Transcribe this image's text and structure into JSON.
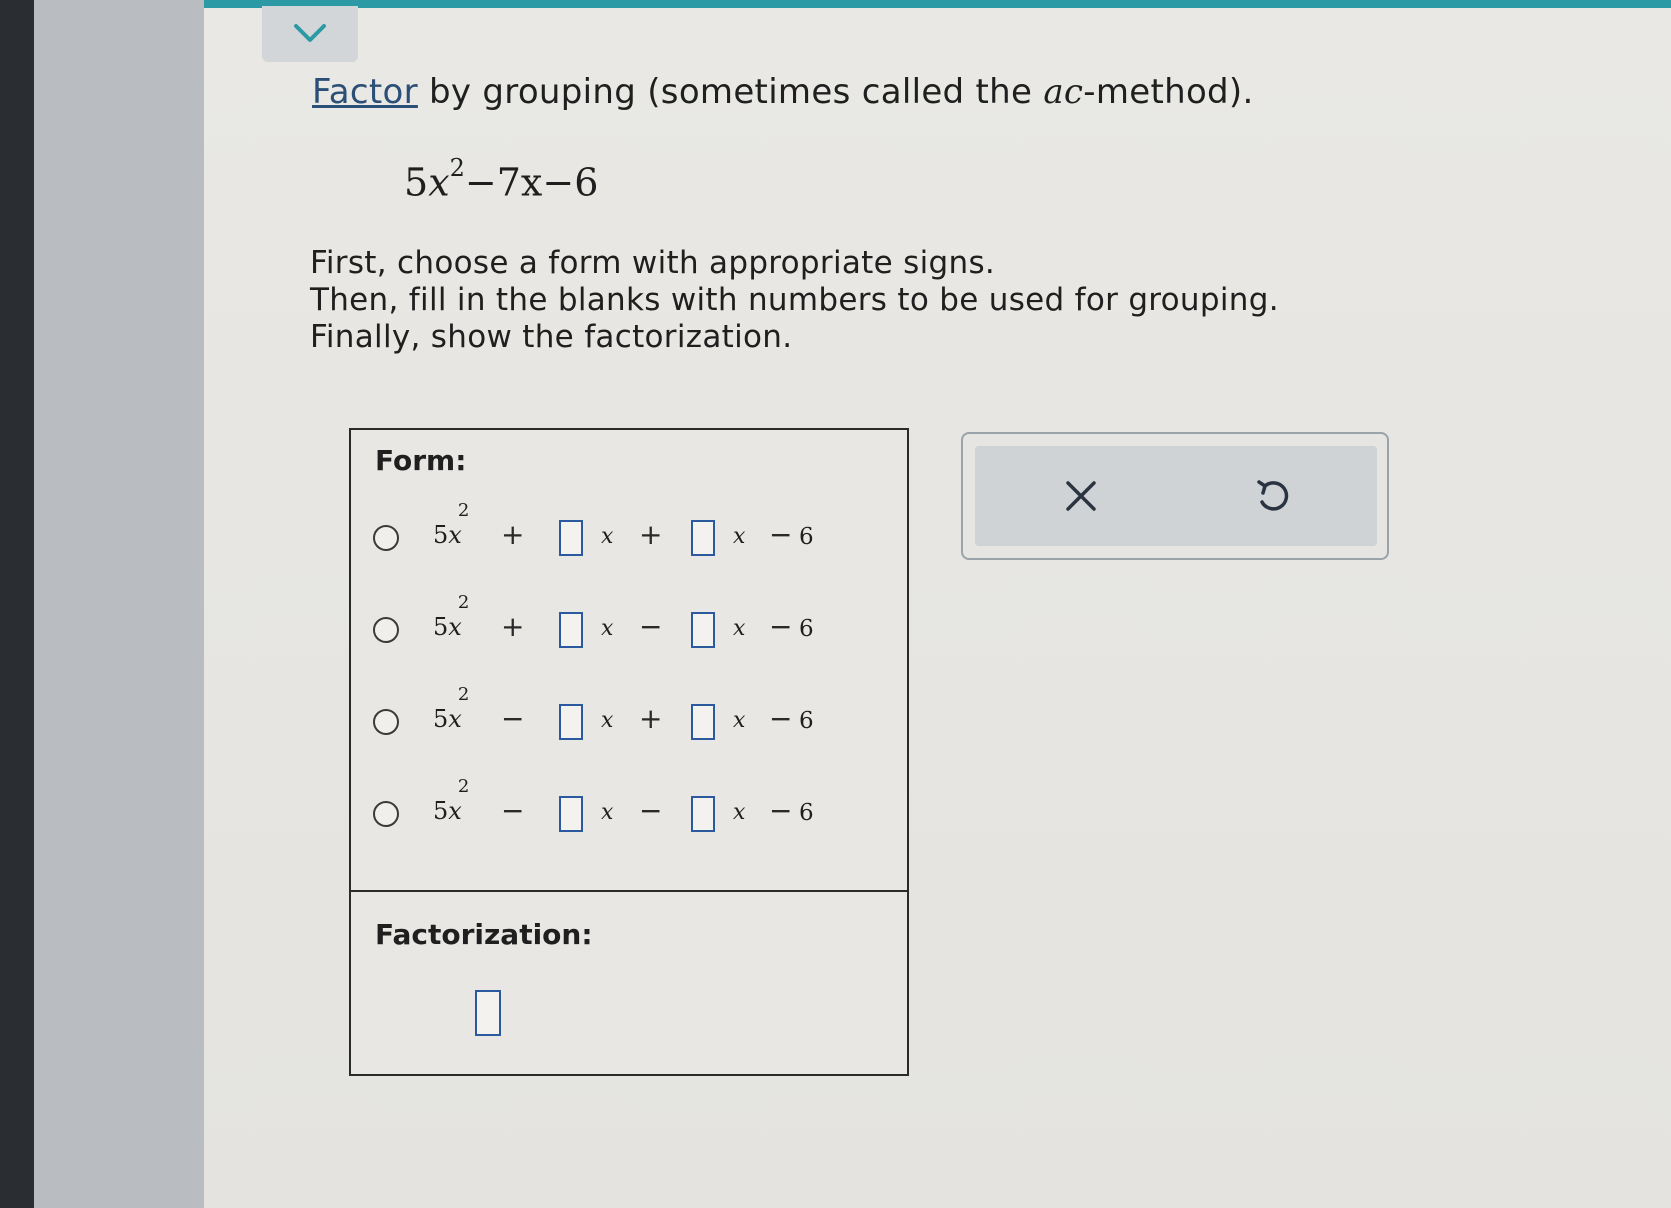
{
  "header": {
    "title_link": "Factor",
    "title_pre": " by grouping (sometimes called the ",
    "title_italic": "ac",
    "title_post": "-method)."
  },
  "expression": {
    "coef": "5",
    "var": "x",
    "exp": "2",
    "rest": "−7x−6"
  },
  "instructions": [
    "First, choose a form with appropriate signs.",
    "Then, fill in the blanks with numbers to be used for grouping.",
    "Finally, show the factorization."
  ],
  "form": {
    "label": "Form:",
    "lead_coef": "5",
    "lead_var": "x",
    "lead_exp": "2",
    "var": "x",
    "constant_sign": "−",
    "constant": "6",
    "options": [
      {
        "op1": "+",
        "op2": "+"
      },
      {
        "op1": "+",
        "op2": "−"
      },
      {
        "op1": "−",
        "op2": "+"
      },
      {
        "op1": "−",
        "op2": "−"
      }
    ]
  },
  "factorization": {
    "label": "Factorization:"
  },
  "actions": {
    "clear_symbol": "✕",
    "undo_symbol": "↺"
  },
  "icons": {
    "expand": "chevron-down-icon",
    "clear": "close-icon",
    "undo": "undo-icon"
  },
  "colors": {
    "accent_bar": "#2b9aa4",
    "link": "#2c4f77",
    "blank_border": "#2c5aa0"
  }
}
